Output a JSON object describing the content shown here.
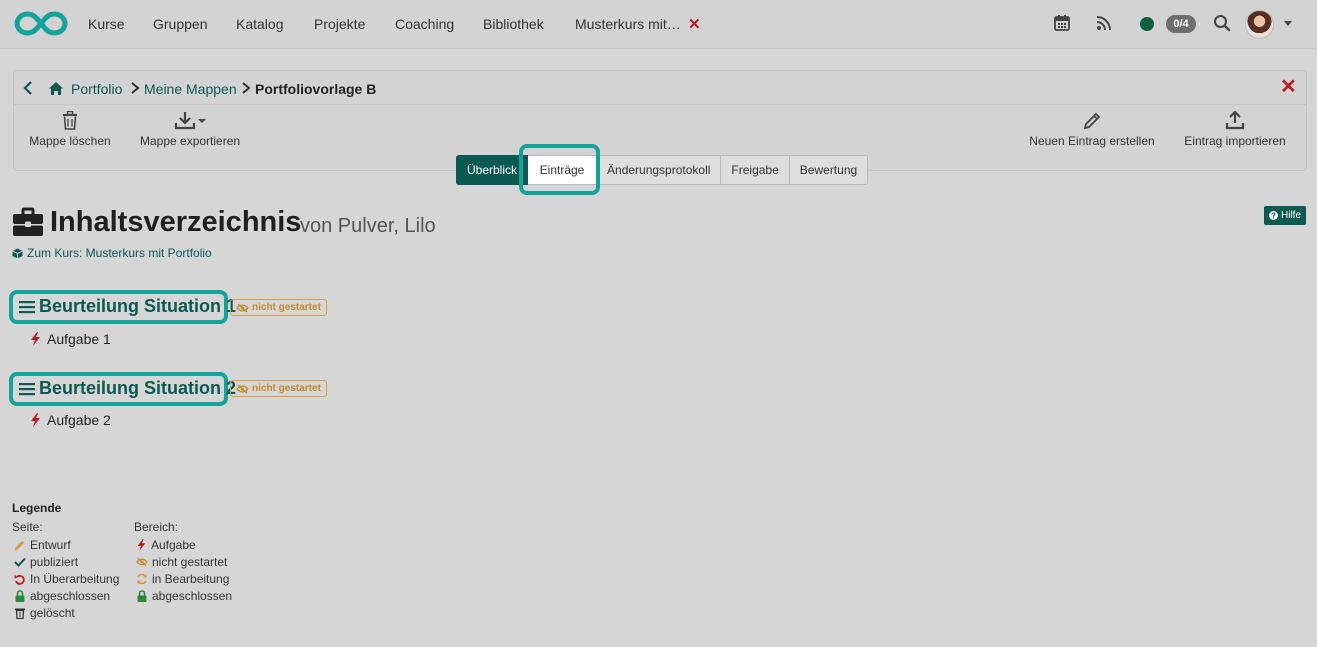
{
  "nav": {
    "items": [
      "Kurse",
      "Gruppen",
      "Katalog",
      "Projekte",
      "Coaching",
      "Bibliothek",
      "Musterkurs mit…"
    ],
    "counter": "0/4",
    "status_color": "#0c5f3a"
  },
  "breadcrumb": {
    "items": [
      "Portfolio",
      "Meine Mappen"
    ],
    "current": "Portfoliovorlage B"
  },
  "toolbar": {
    "delete_label": "Mappe löschen",
    "export_label": "Mappe exportieren",
    "new_entry_label": "Neuen Eintrag erstellen",
    "import_label": "Eintrag importieren"
  },
  "tabs": [
    {
      "label": "Überblick",
      "active": true
    },
    {
      "label": "Einträge",
      "active": false
    },
    {
      "label": "Änderungsprotokoll",
      "active": false
    },
    {
      "label": "Freigabe",
      "active": false
    },
    {
      "label": "Bewertung",
      "active": false
    }
  ],
  "page": {
    "title": "Inhaltsverzeichnis",
    "subtitle": "von Pulver, Lilo",
    "course_link": "Zum Kurs: Musterkurs mit Portfolio",
    "help_label": "Hilfe"
  },
  "sections": [
    {
      "title": "Beurteilung Situation 1",
      "status": "nicht gestartet",
      "task": "Aufgabe 1"
    },
    {
      "title": "Beurteilung Situation 2",
      "status": "nicht gestartet",
      "task": "Aufgabe 2"
    }
  ],
  "legend": {
    "title": "Legende",
    "page_head": "Seite:",
    "area_head": "Bereich:",
    "page_items": [
      "Entwurf",
      "publiziert",
      "In Überarbeitung",
      "abgeschlossen",
      "gelöscht"
    ],
    "area_items": [
      "Aufgabe",
      "nicht gestartet",
      "in Bearbeitung",
      "abgeschlossen"
    ]
  },
  "colors": {
    "accent": "#0b5a52",
    "highlight": "#12a39b",
    "close": "#c0181f",
    "status_tag": "#c28a2a"
  },
  "icons": [
    "logo-infinity-icon",
    "calendar-icon",
    "rss-icon",
    "search-icon",
    "back-icon",
    "home-icon",
    "trash-icon",
    "download-icon",
    "pencil-icon",
    "upload-icon",
    "briefcase-icon",
    "cube-icon",
    "question-icon",
    "list-icon",
    "eye-slash-icon",
    "bolt-icon",
    "check-icon",
    "undo-icon",
    "refresh-icon",
    "lock-icon"
  ]
}
